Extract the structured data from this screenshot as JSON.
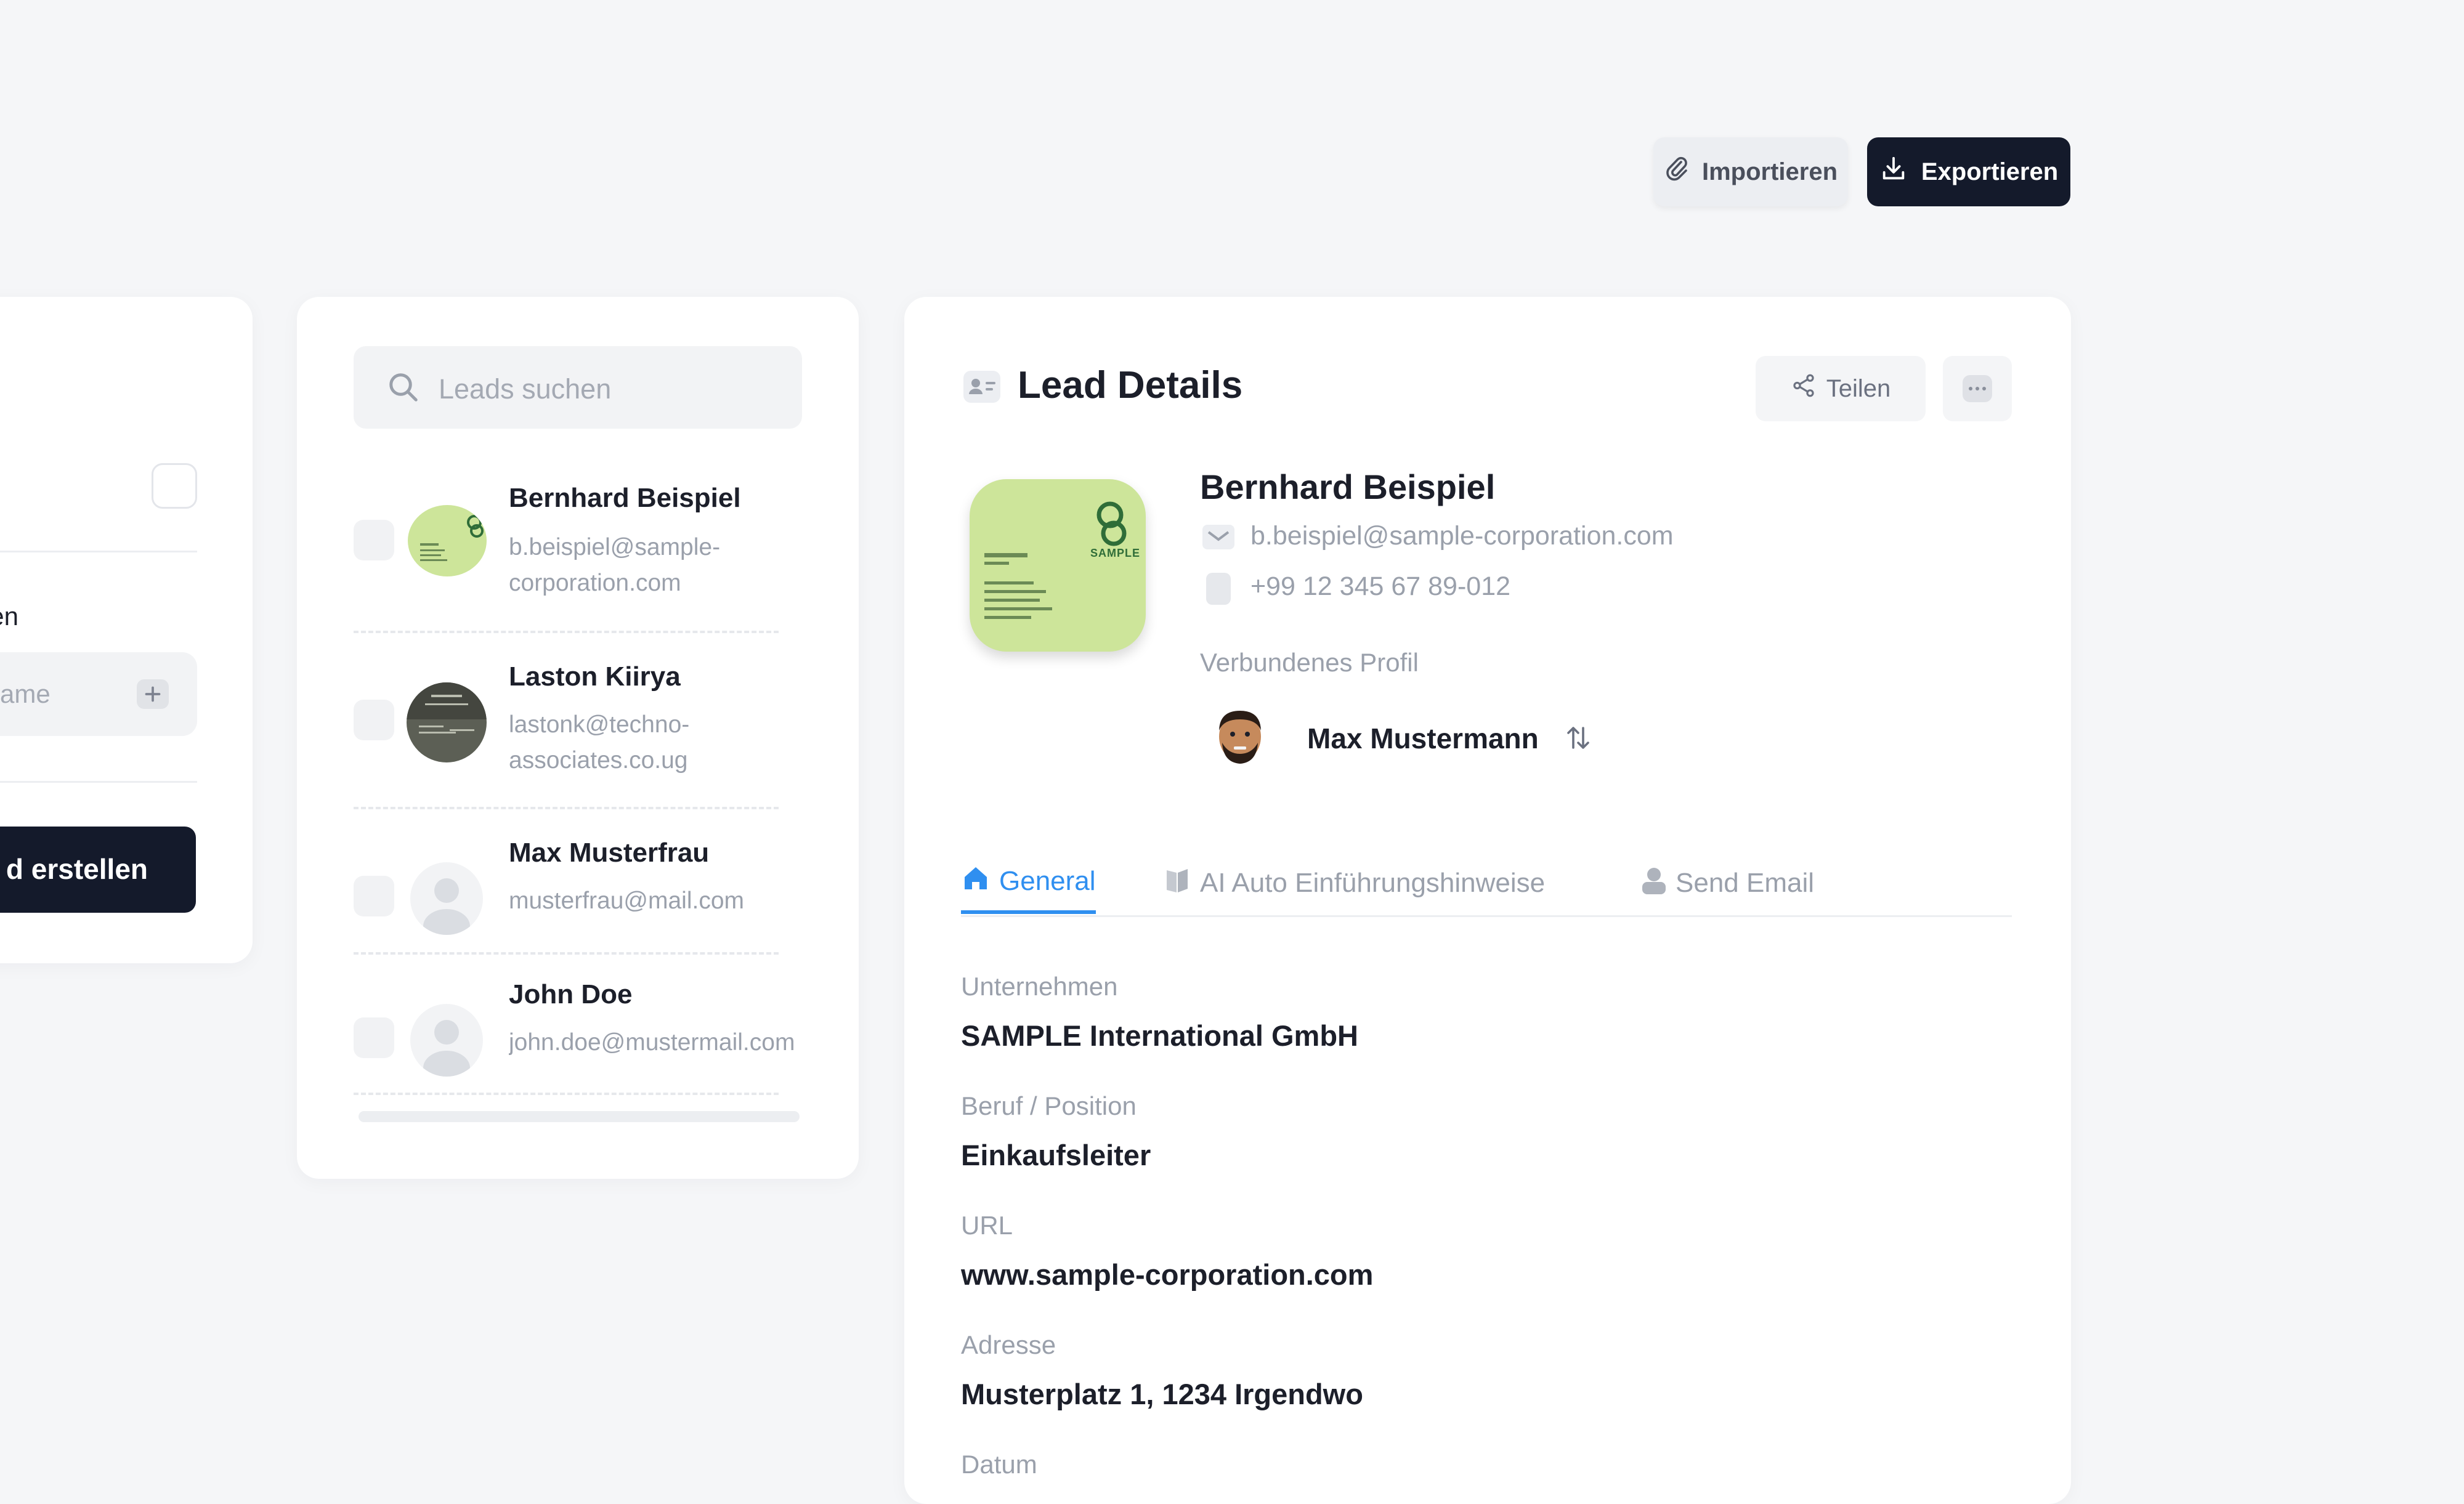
{
  "toolbar": {
    "import_label": "Importieren",
    "export_label": "Exportieren"
  },
  "left_panel": {
    "section_label_fragment": "ellen",
    "input_placeholder_fragment": "ame",
    "create_button_fragment": "d erstellen"
  },
  "leads": {
    "search_placeholder": "Leads suchen",
    "items": [
      {
        "name": "Bernhard Beispiel",
        "email_line1": "b.beispiel@sample-",
        "email_line2": "corporation.com",
        "avatar": "business-card"
      },
      {
        "name": "Laston Kiirya",
        "email_line1": "lastonk@techno-",
        "email_line2": "associates.co.ug",
        "avatar": "business-card-dark"
      },
      {
        "name": "Max Musterfrau",
        "email_line1": "musterfrau@mail.com",
        "email_line2": "",
        "avatar": "person-placeholder"
      },
      {
        "name": "John Doe",
        "email_line1": "john.doe@mustermail.com",
        "email_line2": "",
        "avatar": "person-placeholder"
      }
    ]
  },
  "details": {
    "title": "Lead Details",
    "share_label": "Teilen",
    "name": "Bernhard Beispiel",
    "email": "b.beispiel@sample-corporation.com",
    "phone": "+99 12 345 67 89-012",
    "connected_profile_label": "Verbundenes Profil",
    "connected_profile_name": "Max Mustermann",
    "card_logo_text": "SAMPLE",
    "tabs": [
      {
        "label": "General",
        "icon": "home-icon",
        "active": true
      },
      {
        "label": "AI Auto Einführungshinweise",
        "icon": "book-icon",
        "active": false
      },
      {
        "label": "Send Email",
        "icon": "person-icon",
        "active": false
      }
    ],
    "fields": [
      {
        "label": "Unternehmen",
        "value": "SAMPLE International GmbH"
      },
      {
        "label": "Beruf / Position",
        "value": "Einkaufsleiter"
      },
      {
        "label": "URL",
        "value": "www.sample-corporation.com"
      },
      {
        "label": "Adresse",
        "value": "Musterplatz 1, 1234 Irgendwo"
      },
      {
        "label": "Datum",
        "value": ""
      }
    ]
  },
  "colors": {
    "accent": "#2f8ff0",
    "dark_button": "#141a2b",
    "card_green": "#cde59a"
  }
}
